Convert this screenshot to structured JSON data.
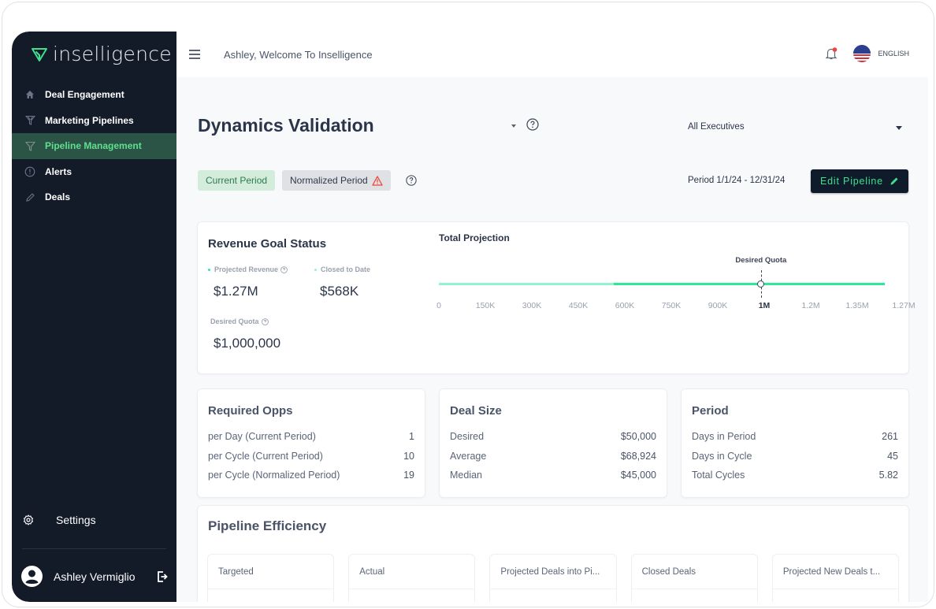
{
  "app": {
    "brand": "inselligence",
    "brand_color": "#3ee08e",
    "sidebar_bg": "#131a28"
  },
  "sidebar": {
    "items": [
      {
        "label": "Deal Engagement",
        "icon": "home-icon",
        "active": false
      },
      {
        "label": "Marketing Pipelines",
        "icon": "funnel-multi-icon",
        "active": false
      },
      {
        "label": "Pipeline Management",
        "icon": "funnel-icon",
        "active": true
      },
      {
        "label": "Alerts",
        "icon": "alert-circle-icon",
        "active": false
      },
      {
        "label": "Deals",
        "icon": "pencil-icon",
        "active": false
      }
    ],
    "settings_label": "Settings",
    "user_name": "Ashley Vermiglio"
  },
  "topbar": {
    "welcome": "Ashley, Welcome To Inselligence",
    "language": "ENGLISH",
    "notification_dot_color": "#f04438"
  },
  "header": {
    "title": "Dynamics Validation",
    "executive_select": "All Executives",
    "tags": {
      "current": "Current Period",
      "normalized": "Normalized Period"
    },
    "period": "Period 1/1/24 - 12/31/24",
    "edit_button": "Edit Pipeline"
  },
  "revenue": {
    "title": "Revenue Goal Status",
    "projected_label": "Projected Revenue",
    "projected_value": "$1.27M",
    "closed_label": "Closed to Date",
    "closed_value": "$568K",
    "quota_label": "Desired Quota",
    "quota_value": "$1,000,000"
  },
  "projection": {
    "title": "Total Projection",
    "marker_label": "Desired Quota",
    "ticks": [
      "0",
      "150K",
      "300K",
      "450K",
      "600K",
      "750K",
      "900K",
      "1M",
      "1.2M",
      "1.35M",
      "1.27M"
    ],
    "highlight_tick": "1M",
    "closed_fraction": 0.38,
    "quota_fraction": 0.7,
    "projected_fraction": 1.0,
    "closed_color": "#8ff5d1",
    "projected_color": "#2ee89a"
  },
  "required_opps": {
    "title": "Required Opps",
    "rows": [
      {
        "label": "per Day (Current Period)",
        "value": "1"
      },
      {
        "label": "per Cycle (Current Period)",
        "value": "10"
      },
      {
        "label": "per Cycle (Normalized Period)",
        "value": "19"
      }
    ]
  },
  "deal_size": {
    "title": "Deal Size",
    "rows": [
      {
        "label": "Desired",
        "value": "$50,000"
      },
      {
        "label": "Average",
        "value": "$68,924"
      },
      {
        "label": "Median",
        "value": "$45,000"
      }
    ]
  },
  "period_stats": {
    "title": "Period",
    "rows": [
      {
        "label": "Days in Period",
        "value": "261"
      },
      {
        "label": "Days in Cycle",
        "value": "45"
      },
      {
        "label": "Total Cycles",
        "value": "5.82"
      }
    ]
  },
  "efficiency": {
    "title": "Pipeline Efficiency",
    "tiles": [
      {
        "label": "Targeted"
      },
      {
        "label": "Actual"
      },
      {
        "label": "Projected Deals into Pi..."
      },
      {
        "label": "Closed Deals"
      },
      {
        "label": "Projected New Deals t..."
      }
    ]
  }
}
